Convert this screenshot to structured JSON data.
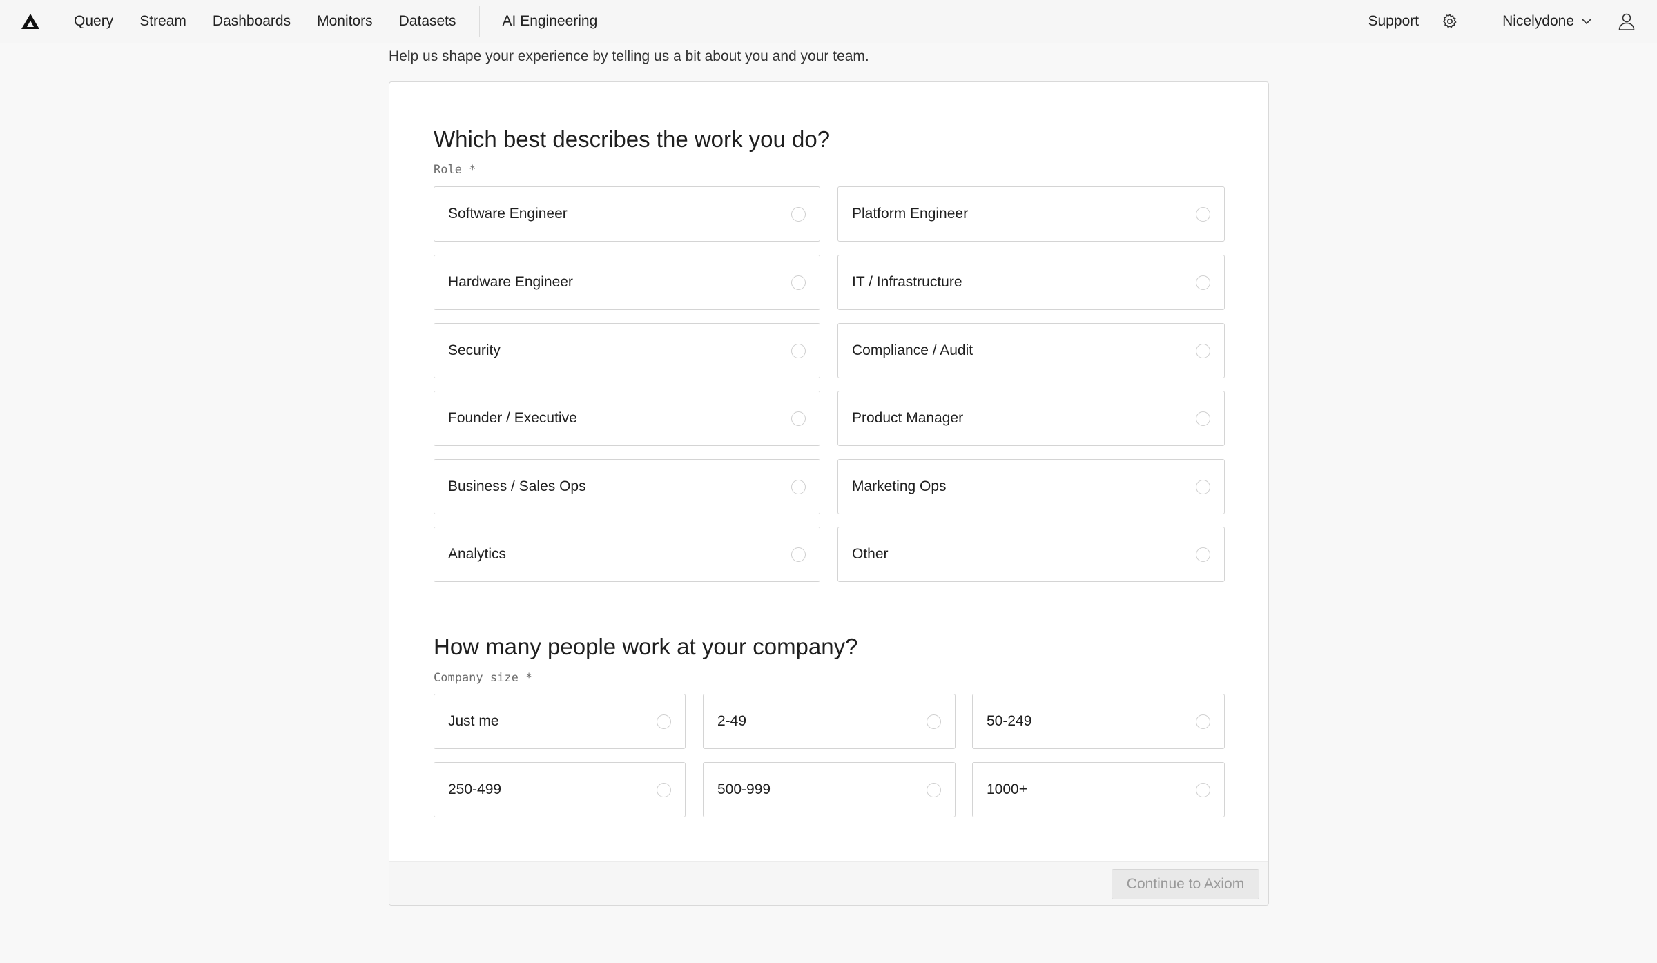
{
  "nav": {
    "items": [
      "Query",
      "Stream",
      "Dashboards",
      "Monitors",
      "Datasets"
    ],
    "extra": "AI Engineering",
    "support": "Support",
    "org": "Nicelydone"
  },
  "intro": "Help us shape your experience by telling us a bit about you and your team.",
  "role": {
    "title": "Which best describes the work you do?",
    "label": "Role *",
    "options": [
      "Software Engineer",
      "Platform Engineer",
      "Hardware Engineer",
      "IT / Infrastructure",
      "Security",
      "Compliance / Audit",
      "Founder / Executive",
      "Product Manager",
      "Business / Sales Ops",
      "Marketing Ops",
      "Analytics",
      "Other"
    ]
  },
  "company": {
    "title": "How many people work at your company?",
    "label": "Company size *",
    "options": [
      "Just me",
      "2-49",
      "50-249",
      "250-499",
      "500-999",
      "1000+"
    ]
  },
  "footer": {
    "continue_label": "Continue to Axiom"
  },
  "colors": {
    "accent_disabled": "#e9e9e9",
    "border": "#d4d4d4"
  }
}
